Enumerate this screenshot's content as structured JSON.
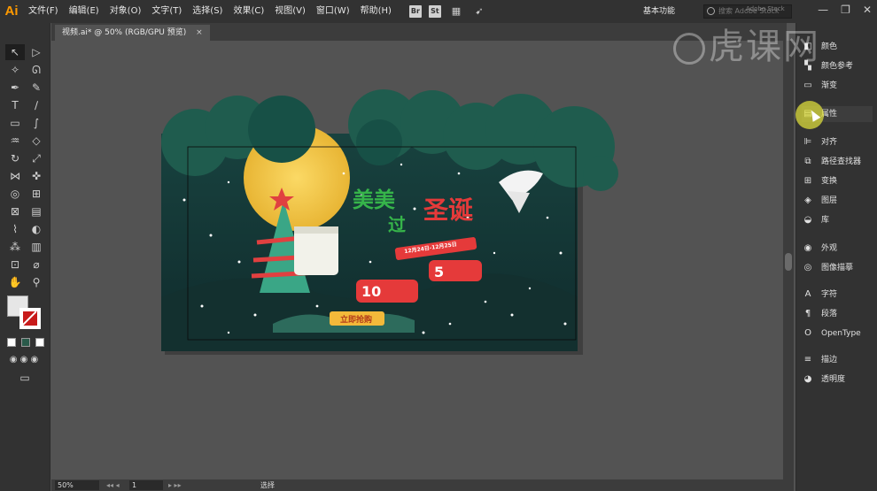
{
  "app": {
    "logo": "Ai",
    "menus": [
      "文件(F)",
      "编辑(E)",
      "对象(O)",
      "文字(T)",
      "选择(S)",
      "效果(C)",
      "视图(V)",
      "窗口(W)",
      "帮助(H)"
    ],
    "toolbar_icons": [
      "Br",
      "St"
    ],
    "workspace": "基本功能",
    "search_placeholder": "搜索 Adobe Stock",
    "window_buttons": [
      "—",
      "❐",
      "✕"
    ]
  },
  "document": {
    "tab_label": "视频.ai* @ 50% (RGB/GPU 预览)",
    "tab_close": "×"
  },
  "status": {
    "zoom": "50%",
    "page": "1",
    "tool": "选择"
  },
  "panels": [
    {
      "label": "颜色",
      "icon": "color-icon"
    },
    {
      "label": "颜色参考",
      "icon": "color-guide-icon"
    },
    {
      "label": "渐变",
      "icon": "gradient-icon"
    },
    {
      "label": "属性",
      "icon": "properties-icon"
    },
    {
      "label": "对齐",
      "icon": "align-icon"
    },
    {
      "label": "路径查找器",
      "icon": "pathfinder-icon"
    },
    {
      "label": "变换",
      "icon": "transform-icon"
    },
    {
      "label": "图层",
      "icon": "layers-icon"
    },
    {
      "label": "库",
      "icon": "libraries-icon"
    },
    {
      "label": "外观",
      "icon": "appearance-icon"
    },
    {
      "label": "图像描摹",
      "icon": "image-trace-icon"
    },
    {
      "label": "字符",
      "icon": "character-icon"
    },
    {
      "label": "段落",
      "icon": "paragraph-icon"
    },
    {
      "label": "OpenType",
      "icon": "opentype-icon"
    },
    {
      "label": "描边",
      "icon": "stroke-icon"
    },
    {
      "label": "透明度",
      "icon": "transparency-icon"
    }
  ],
  "artwork": {
    "headline_1": "美美",
    "headline_2": "过",
    "headline_3": "圣诞",
    "ribbon": "12月24日-12月25日",
    "badge_1_number": "10",
    "badge_2_number": "5",
    "cta": "立即抢购"
  },
  "watermark": {
    "text": "虎课网",
    "small": "Adobe Stock"
  },
  "colors": {
    "accent": "#ff9a00",
    "artboard_bg": "#1e3b3a",
    "tree_green": "#1f5c4e",
    "moon": "#f3c84a",
    "red": "#e53a3a"
  }
}
